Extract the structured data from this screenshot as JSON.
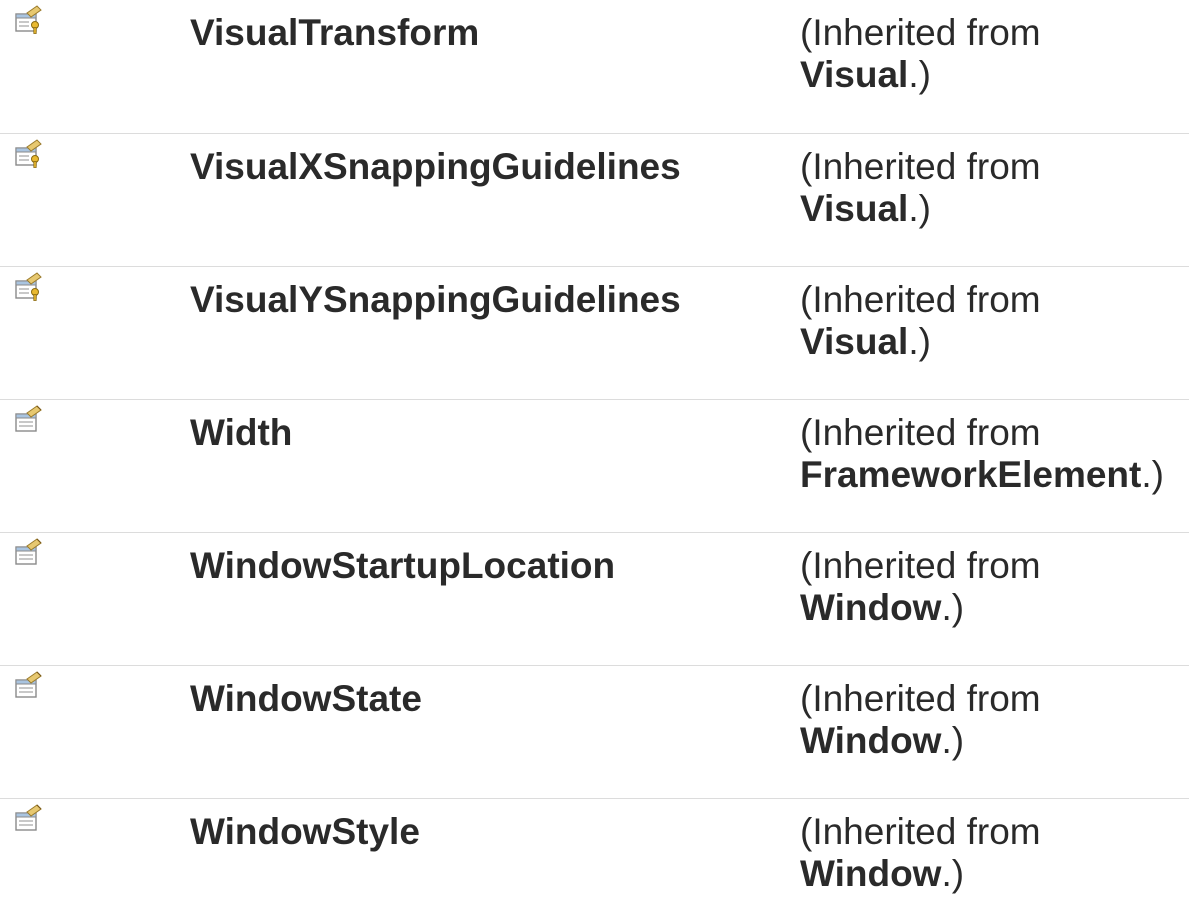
{
  "members": [
    {
      "icon": "protected-property-icon",
      "name": "VisualTransform",
      "inherited_prefix": "(Inherited from",
      "inherited_class": "Visual",
      "inherited_suffix": ".)"
    },
    {
      "icon": "protected-property-icon",
      "name": "VisualXSnappingGuidelines",
      "inherited_prefix": "(Inherited from",
      "inherited_class": "Visual",
      "inherited_suffix": ".)"
    },
    {
      "icon": "protected-property-icon",
      "name": "VisualYSnappingGuidelines",
      "inherited_prefix": "(Inherited from",
      "inherited_class": "Visual",
      "inherited_suffix": ".)"
    },
    {
      "icon": "public-property-icon",
      "name": "Width",
      "inherited_prefix": "(Inherited from",
      "inherited_class": "FrameworkElement",
      "inherited_suffix": ".)"
    },
    {
      "icon": "public-property-icon",
      "name": "WindowStartupLocation",
      "inherited_prefix": "(Inherited from",
      "inherited_class": "Window",
      "inherited_suffix": ".)"
    },
    {
      "icon": "public-property-icon",
      "name": "WindowState",
      "inherited_prefix": "(Inherited from",
      "inherited_class": "Window",
      "inherited_suffix": ".)"
    },
    {
      "icon": "public-property-icon",
      "name": "WindowStyle",
      "inherited_prefix": "(Inherited from",
      "inherited_class": "Window",
      "inherited_suffix": ".)"
    }
  ]
}
